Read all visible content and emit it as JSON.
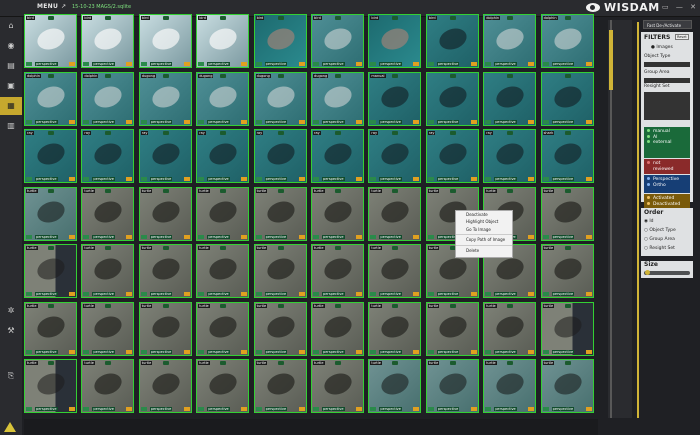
{
  "header": {
    "menu_label": "MENU",
    "path": "15-10-23 MAGS/2.sqlite"
  },
  "logo": {
    "text": "WISDAM"
  },
  "window_buttons": [
    "▭",
    "—",
    "✕"
  ],
  "context_menu": {
    "items": [
      "Deactivate",
      "Highlight Object",
      "Go To Image",
      "Copy Path of Image",
      "Delete"
    ]
  },
  "right_panel": {
    "fast_button": "Fast De-/Activate",
    "filters_title": "FILTERS",
    "reset_label": "Reset",
    "images_label": "Images",
    "object_type_label": "Object Type",
    "group_area_label": "Group Area",
    "resight_label": "Resight Set",
    "review_states": [
      "manual",
      "AI",
      "external"
    ],
    "not_reviewed": [
      "not",
      "reviewed"
    ],
    "view_modes": [
      "Perspective",
      "Ortho"
    ],
    "activation": [
      "Activated",
      "Deactivated"
    ],
    "order_title": "Order",
    "order_options": [
      "Id",
      "Object Type",
      "Group Area",
      "Resight Set"
    ],
    "size_title": "Size"
  },
  "sidebar_icons": [
    "home-icon",
    "globe-icon",
    "layers-icon",
    "camera-icon",
    "grid-icon",
    "folder-icon",
    "settings-icon",
    "tools-icon",
    "export-icon"
  ],
  "tiles": [
    {
      "label": "bird",
      "kind": "sky"
    },
    {
      "label": "bird",
      "kind": "sky"
    },
    {
      "label": "bird",
      "kind": "sky"
    },
    {
      "label": "bird",
      "kind": "sky"
    },
    {
      "label": "bird",
      "kind": "sea"
    },
    {
      "label": "bird",
      "kind": "seab"
    },
    {
      "label": "bird",
      "kind": "sea"
    },
    {
      "label": "bird",
      "kind": "ray"
    },
    {
      "label": "dolphin",
      "kind": "seab"
    },
    {
      "label": "dolphin",
      "kind": "seab"
    },
    {
      "label": "dolphin",
      "kind": "seab"
    },
    {
      "label": "dolphin",
      "kind": "seab"
    },
    {
      "label": "dugong",
      "kind": "seab"
    },
    {
      "label": "dugong",
      "kind": "seab"
    },
    {
      "label": "dugong",
      "kind": "seab"
    },
    {
      "label": "dugong",
      "kind": "seab"
    },
    {
      "label": "manual",
      "kind": "ray"
    },
    {
      "label": "",
      "kind": "ray"
    },
    {
      "label": "",
      "kind": "ray"
    },
    {
      "label": "",
      "kind": "ray"
    },
    {
      "label": "ray",
      "kind": "ray"
    },
    {
      "label": "ray",
      "kind": "ray"
    },
    {
      "label": "ray",
      "kind": "ray"
    },
    {
      "label": "ray",
      "kind": "ray"
    },
    {
      "label": "ray",
      "kind": "ray"
    },
    {
      "label": "ray",
      "kind": "ray"
    },
    {
      "label": "ray",
      "kind": "ray"
    },
    {
      "label": "ray",
      "kind": "ray"
    },
    {
      "label": "ray",
      "kind": "ray"
    },
    {
      "label": "shark",
      "kind": "ray"
    },
    {
      "label": "turtle",
      "kind": "tealrock"
    },
    {
      "label": "turtle",
      "kind": "rock"
    },
    {
      "label": "turtle",
      "kind": "rock"
    },
    {
      "label": "turtle",
      "kind": "rock"
    },
    {
      "label": "turtle",
      "kind": "rock"
    },
    {
      "label": "turtle",
      "kind": "rock"
    },
    {
      "label": "turtle",
      "kind": "rock"
    },
    {
      "label": "turtle",
      "kind": "rock"
    },
    {
      "label": "turtle",
      "kind": "rock"
    },
    {
      "label": "turtle",
      "kind": "rock"
    },
    {
      "label": "turtle",
      "kind": "half"
    },
    {
      "label": "turtle",
      "kind": "rock"
    },
    {
      "label": "turtle",
      "kind": "rock"
    },
    {
      "label": "turtle",
      "kind": "rock"
    },
    {
      "label": "turtle",
      "kind": "rock"
    },
    {
      "label": "turtle",
      "kind": "rock"
    },
    {
      "label": "turtle",
      "kind": "rock"
    },
    {
      "label": "turtle",
      "kind": "rock"
    },
    {
      "label": "turtle",
      "kind": "rock"
    },
    {
      "label": "turtle",
      "kind": "rock"
    },
    {
      "label": "turtle",
      "kind": "rock"
    },
    {
      "label": "turtle",
      "kind": "rock"
    },
    {
      "label": "turtle",
      "kind": "rock"
    },
    {
      "label": "turtle",
      "kind": "rock"
    },
    {
      "label": "turtle",
      "kind": "rock"
    },
    {
      "label": "turtle",
      "kind": "rock"
    },
    {
      "label": "turtle",
      "kind": "rock"
    },
    {
      "label": "turtle",
      "kind": "rock"
    },
    {
      "label": "turtle",
      "kind": "rock"
    },
    {
      "label": "turtle",
      "kind": "half"
    },
    {
      "label": "turtle",
      "kind": "half"
    },
    {
      "label": "turtle",
      "kind": "rock"
    },
    {
      "label": "turtle",
      "kind": "rock"
    },
    {
      "label": "turtle",
      "kind": "rock"
    },
    {
      "label": "turtle",
      "kind": "rock"
    },
    {
      "label": "turtle",
      "kind": "rock"
    },
    {
      "label": "turtle",
      "kind": "tealrock"
    },
    {
      "label": "turtle",
      "kind": "tealrock"
    },
    {
      "label": "turtle",
      "kind": "tealrock"
    },
    {
      "label": "turtle",
      "kind": "tealrock"
    }
  ],
  "tile_footer": "perspective"
}
